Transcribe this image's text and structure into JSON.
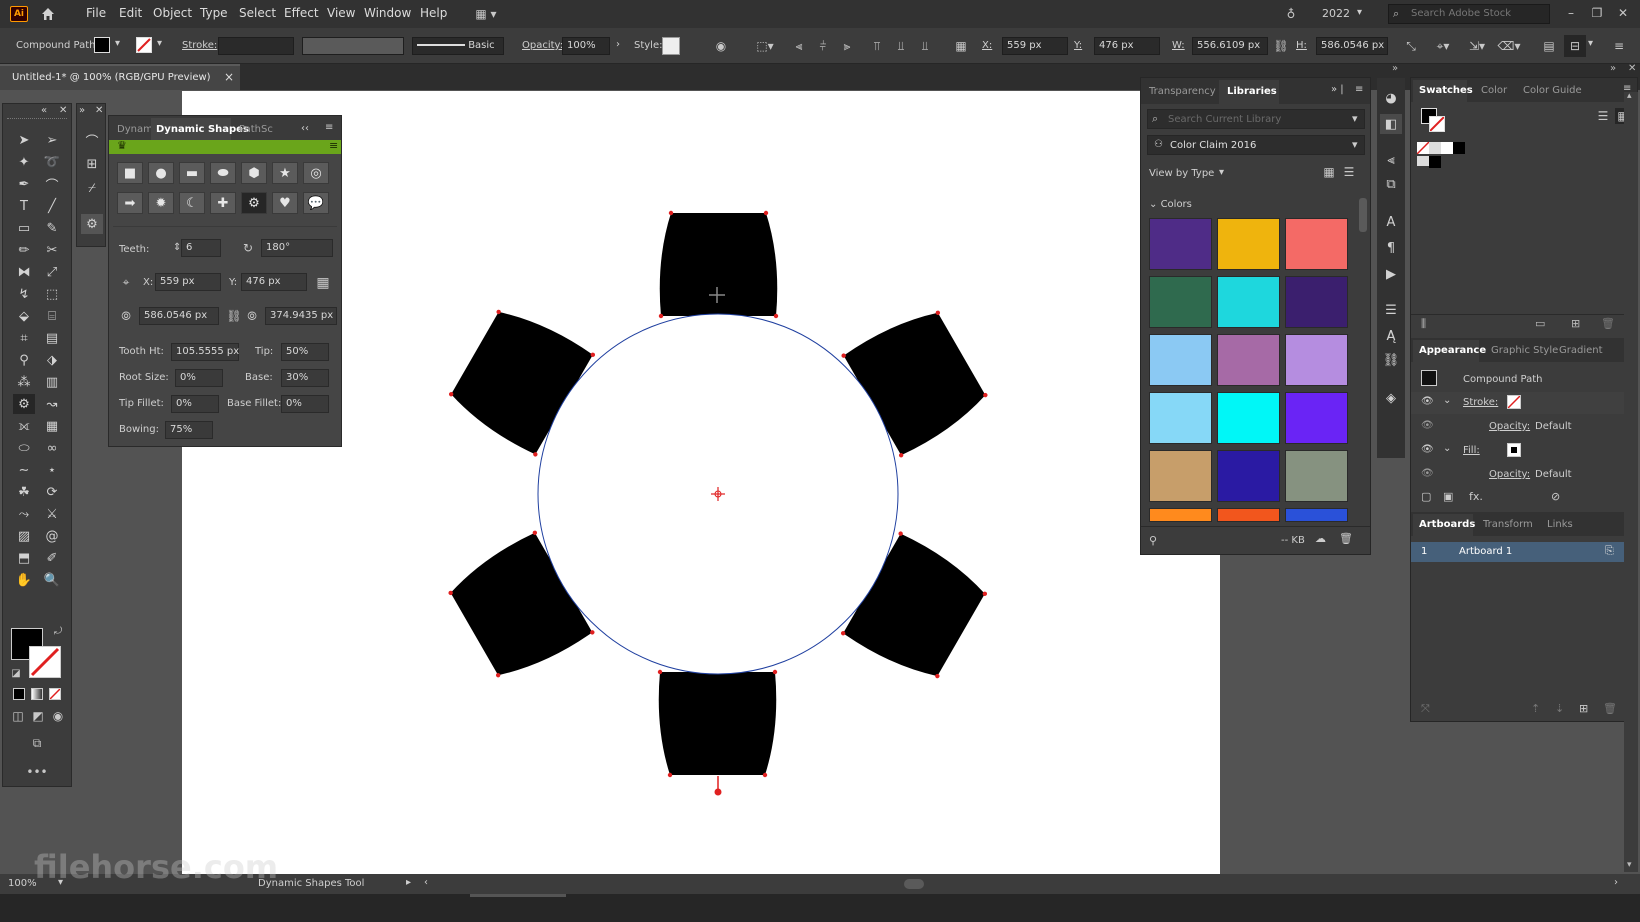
{
  "app": {
    "logo": "Ai",
    "year": "2022",
    "search_placeholder": "Search Adobe Stock"
  },
  "menu": [
    "File",
    "Edit",
    "Object",
    "Type",
    "Select",
    "Effect",
    "View",
    "Window",
    "Help"
  ],
  "control": {
    "object_type": "Compound Path",
    "stroke_label": "Stroke:",
    "brush": "Basic",
    "opacity_label": "Opacity:",
    "opacity": "100%",
    "style_label": "Style:",
    "x_label": "X:",
    "x": "559 px",
    "y_label": "Y:",
    "y": "476 px",
    "w_label": "W:",
    "w": "556.6109 px",
    "h_label": "H:",
    "h": "586.0546 px"
  },
  "document": {
    "tab_title": "Untitled-1* @ 100% (RGB/GPU Preview)",
    "close": "×"
  },
  "dynamic_shapes": {
    "tabs": [
      "Dynam",
      "Dynamic Shapes",
      "PathSc"
    ],
    "teeth_label": "Teeth:",
    "teeth": "6",
    "rotation": "180°",
    "x_label": "X:",
    "x": "559 px",
    "y_label": "Y:",
    "y": "476 px",
    "size1": "586.0546 px",
    "size2": "374.9435 px",
    "tooth_ht_label": "Tooth Ht:",
    "tooth_ht": "105.5555 px",
    "tip_label": "Tip:",
    "tip": "50%",
    "root_size_label": "Root Size:",
    "root_size": "0%",
    "base_label": "Base:",
    "base": "30%",
    "tip_fillet_label": "Tip Fillet:",
    "tip_fillet": "0%",
    "base_fillet_label": "Base Fillet:",
    "base_fillet": "0%",
    "bowing_label": "Bowing:",
    "bowing": "75%"
  },
  "libraries": {
    "tabs": [
      "Transparency",
      "Libraries"
    ],
    "search_placeholder": "Search Current Library",
    "library": "Color Claim 2016",
    "view_by": "View by Type",
    "section": "Colors",
    "size": "-- KB",
    "swatches": [
      "#4f2c87",
      "#efb40d",
      "#f46a66",
      "#2f6a4e",
      "#1ed7dd",
      "#3b1f6e",
      "#8bc9f3",
      "#a66aa6",
      "#b58de0",
      "#86d8f7",
      "#00f7f7",
      "#6a24f5",
      "#c79e6a",
      "#2a1aa3",
      "#869280",
      "#ff8a1d",
      "#f2561d",
      "#2a51d9"
    ]
  },
  "swatches_panel": {
    "tabs": [
      "Swatches",
      "Color",
      "Color Guide"
    ]
  },
  "appearance": {
    "tabs": [
      "Appearance",
      "Graphic Style",
      "Gradient"
    ],
    "object": "Compound Path",
    "stroke_label": "Stroke:",
    "fill_label": "Fill:",
    "opacity_label": "Opacity:",
    "opacity1": "Default",
    "opacity2": "Default",
    "fx": "fx."
  },
  "artboards": {
    "tabs": [
      "Artboards",
      "Transform",
      "Links"
    ],
    "index": "1",
    "name": "Artboard 1"
  },
  "status": {
    "zoom": "100%",
    "tool": "Dynamic Shapes Tool"
  },
  "watermark": "filehorse.com"
}
